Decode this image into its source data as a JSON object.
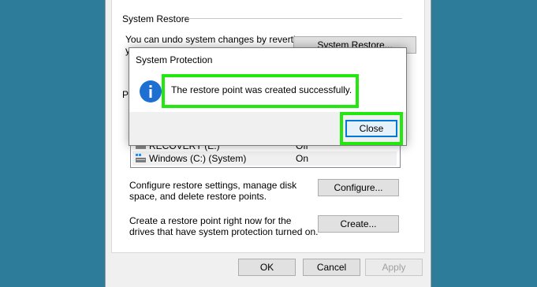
{
  "properties": {
    "system_restore_section": "System Restore",
    "undo_text_line1": "You can undo system changes by reverting",
    "undo_text_line2": "y",
    "system_restore_button": "System Restore...",
    "protection_section_fragment": "P",
    "drives": [
      {
        "name": "RECOVERY (E:)",
        "status": "Off",
        "icon": "drive-icon"
      },
      {
        "name": "Windows (C:) (System)",
        "status": "On",
        "icon": "system-drive-icon"
      }
    ],
    "configure_text": "Configure restore settings, manage disk space, and delete restore points.",
    "configure_button": "Configure...",
    "create_text": "Create a restore point right now for the drives that have system protection turned on.",
    "create_button": "Create...",
    "ok_button": "OK",
    "cancel_button": "Cancel",
    "apply_button": "Apply"
  },
  "dialog": {
    "title": "System Protection",
    "icon": "info-icon",
    "message": "The restore point was created successfully.",
    "close_button": "Close"
  },
  "colors": {
    "desktop": "#2d7d9a",
    "highlight": "#22e80f",
    "info_icon": "#1d6fd1"
  }
}
